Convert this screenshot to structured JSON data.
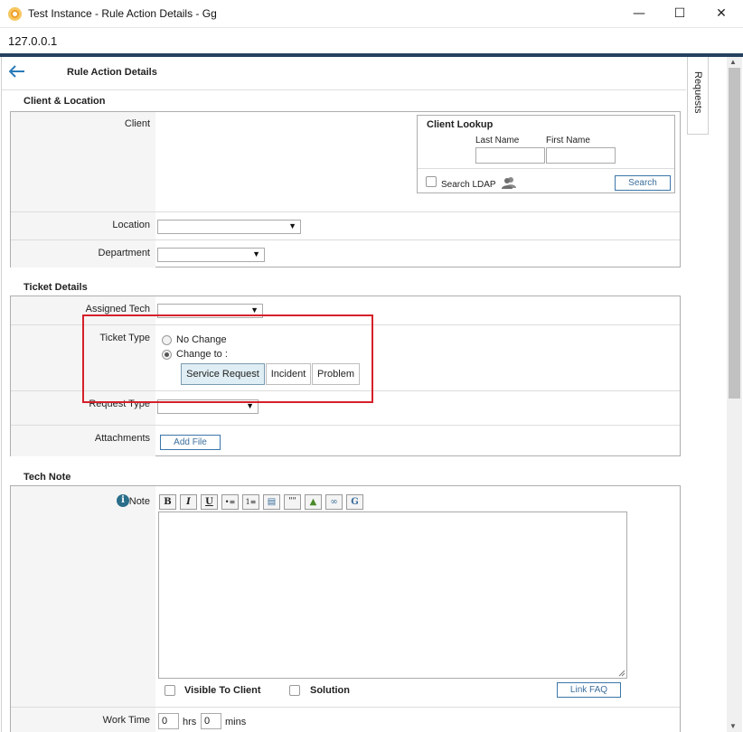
{
  "window": {
    "title": "Test Instance - Rule Action Details - Gg",
    "minimize_glyph": "—",
    "maximize_glyph": "☐",
    "close_glyph": "✕",
    "address": "127.0.0.1"
  },
  "page": {
    "title": "Rule Action Details"
  },
  "client_location": {
    "section_title": "Client & Location",
    "client_label": "Client",
    "lookup": {
      "title": "Client Lookup",
      "last_name_label": "Last Name",
      "last_name_value": "",
      "first_name_label": "First Name",
      "first_name_value": "",
      "search_ldap_label": "Search LDAP",
      "search_button": "Search"
    },
    "location_label": "Location",
    "location_value": "",
    "department_label": "Department",
    "department_value": ""
  },
  "ticket_details": {
    "section_title": "Ticket Details",
    "assigned_tech_label": "Assigned Tech",
    "assigned_tech_value": "",
    "ticket_type_label": "Ticket Type",
    "no_change_label": "No Change",
    "change_to_label": "Change to :",
    "type_options": [
      "Service Request",
      "Incident",
      "Problem"
    ],
    "selected_type": "Service Request",
    "request_type_label": "Request Type",
    "request_type_value": "",
    "attachments_label": "Attachments",
    "add_file_button": "Add File"
  },
  "tech_note": {
    "section_title": "Tech Note",
    "note_label": "Note",
    "toolbar": [
      "B",
      "I",
      "U",
      "•≡",
      "1≡",
      "▤",
      "\"\"",
      "▲",
      "∞",
      "G"
    ],
    "visible_to_client_label": "Visible To Client",
    "solution_label": "Solution",
    "link_faq_button": "Link FAQ",
    "work_time_label": "Work Time",
    "hrs_value": "0",
    "hrs_label": "hrs",
    "mins_value": "0",
    "mins_label": "mins"
  },
  "side_tab": {
    "label": "Requests"
  },
  "colors": {
    "accent_bar": "#26415f",
    "highlight_border": "#d6202a",
    "button_text": "#3a6e9c"
  }
}
